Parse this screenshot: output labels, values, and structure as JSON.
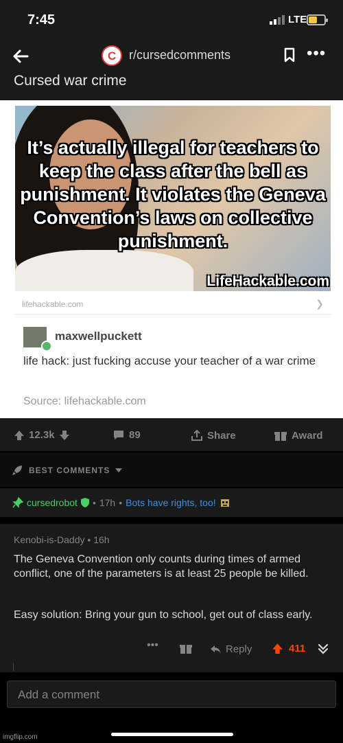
{
  "status_bar": {
    "time": "7:45",
    "network": "LTE"
  },
  "header": {
    "subreddit": "r/cursedcomments",
    "post_title": "Cursed war crime",
    "back_icon": "arrow-left-icon",
    "bookmark_icon": "bookmark-icon",
    "more_icon": "more-horizontal-icon"
  },
  "post_image": {
    "caption": "It’s actually illegal for teachers to keep the class after the bell as punishment. It violates the Geneva Convention’s laws on collective punishment.",
    "site_watermark": "LifeHackable.com",
    "link_domain": "lifehackable.com",
    "tumblr_user": "maxwellpuckett",
    "tumblr_text": "life hack: just fucking accuse your teacher of a war crime",
    "source": "Source: lifehackable.com"
  },
  "actions": {
    "upvotes": "12.3k",
    "comments": "89",
    "share_label": "Share",
    "award_label": "Award"
  },
  "sort": {
    "label": "BEST COMMENTS"
  },
  "bot_comment": {
    "author": "cursedrobot",
    "time": "17h",
    "flair": "Bots have rights, too!"
  },
  "comment": {
    "author": "Kenobi-is-Daddy",
    "time": "16h",
    "paragraph1": "The Geneva Convention only counts during times of armed conflict, one of the parameters is at least 25 people be killed.",
    "paragraph2": "Easy solution: Bring your gun to school, get out of class early.",
    "reply_label": "Reply",
    "score": "411"
  },
  "add_comment": {
    "placeholder": "Add a comment"
  },
  "watermark": "imgflip.com",
  "colors": {
    "accent": "#ff4500",
    "mod_green": "#46d160",
    "flair_blue": "#3d8fe0",
    "surface": "#1a1a1b"
  }
}
